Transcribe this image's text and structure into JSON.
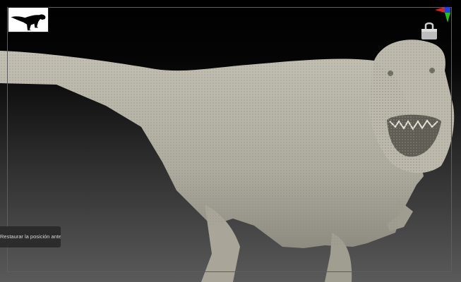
{
  "viewport": {
    "thumbnail_icon": "trex-silhouette-icon",
    "axis_icon": "axis-gizmo-icon",
    "lock_icon": "lock-icon",
    "axis_colors": {
      "x": "#e02020",
      "y": "#20c020",
      "z": "#2040e0"
    },
    "model_color": "#b9b6a9"
  },
  "tooltip": {
    "text": "Restaurar la posición anterior."
  }
}
